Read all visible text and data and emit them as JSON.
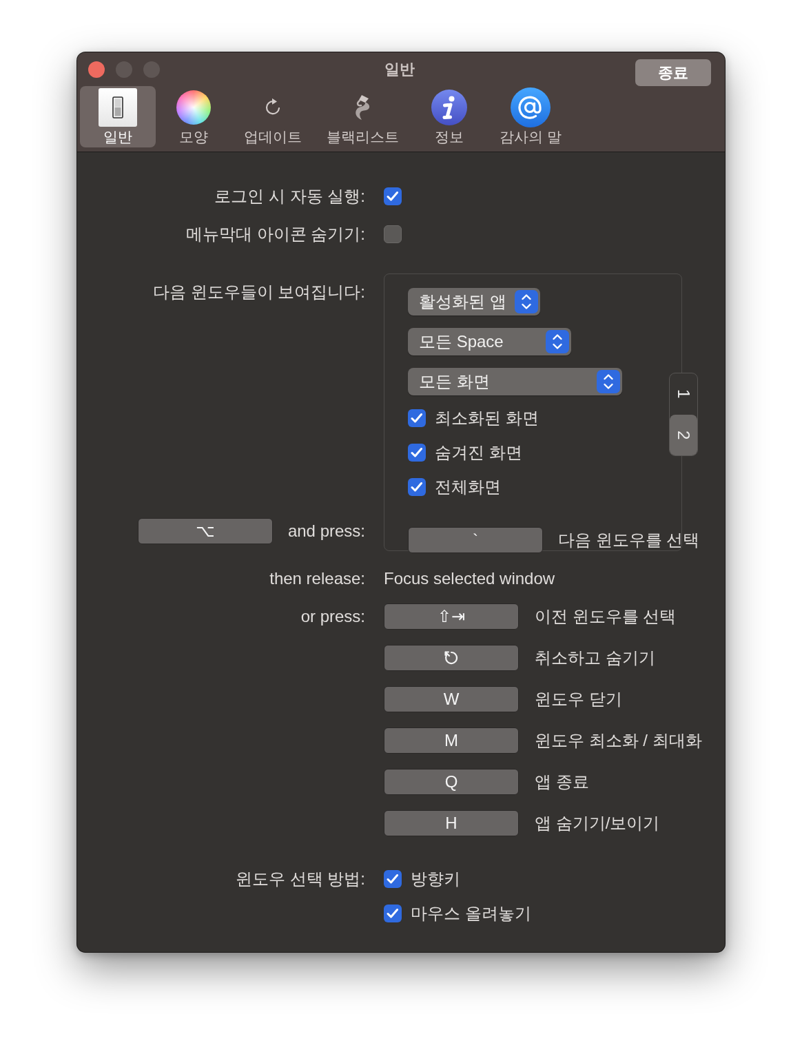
{
  "window": {
    "title": "일반",
    "buttons": [
      {
        "kind": "close",
        "disabled": false
      },
      {
        "kind": "minimize",
        "disabled": true
      },
      {
        "kind": "zoom",
        "disabled": true
      }
    ],
    "quit_button": "종료"
  },
  "toolbar": {
    "items": [
      {
        "kind": "general",
        "label": "일반",
        "selected": true
      },
      {
        "kind": "appearance",
        "label": "모양",
        "selected": false
      },
      {
        "kind": "update",
        "label": "업데이트",
        "selected": false
      },
      {
        "kind": "blacklist",
        "label": "블랙리스트",
        "selected": false
      },
      {
        "kind": "about",
        "label": "정보",
        "selected": false
      },
      {
        "kind": "thanks",
        "label": "감사의 말",
        "selected": false
      }
    ]
  },
  "options": [
    {
      "label": "로그인 시 자동 실행:",
      "checked": true
    },
    {
      "label": "메뉴막대 아이콘 숨기기:",
      "checked": false
    }
  ],
  "shortcut_panel": {
    "label": "다음 윈도우들이 보여집니다:",
    "popups": [
      {
        "value": "활성화된 앱"
      },
      {
        "value": "모든 Space"
      },
      {
        "value": "모든 화면"
      }
    ],
    "filters": [
      {
        "label": "최소화된 화면",
        "checked": true
      },
      {
        "label": "숨겨진 화면",
        "checked": true
      },
      {
        "label": "전체화면",
        "checked": true
      }
    ],
    "trigger": {
      "key": "`",
      "action": "다음 윈도우를 선택"
    },
    "pages": [
      {
        "label": "1",
        "selected": false
      },
      {
        "label": "2",
        "selected": true
      }
    ]
  },
  "hold": {
    "key": "⌥",
    "label": "and press:"
  },
  "release": {
    "label": "then release:",
    "action": "Focus selected window"
  },
  "alternatives": {
    "label": "or press:",
    "shortcuts": [
      {
        "kind": "text",
        "key": "⇧⇥",
        "action": "이전 윈도우를 선택"
      },
      {
        "kind": "icon",
        "action": "취소하고 숨기기"
      },
      {
        "kind": "text",
        "key": "W",
        "action": "윈도우 닫기"
      },
      {
        "kind": "text",
        "key": "M",
        "action": "윈도우 최소화 / 최대화"
      },
      {
        "kind": "text",
        "key": "Q",
        "action": "앱 종료"
      },
      {
        "kind": "text",
        "key": "H",
        "action": "앱 숨기기/보이기"
      }
    ]
  },
  "selection_method": {
    "label": "윈도우 선택 방법:",
    "options": [
      {
        "label": "방향키",
        "checked": true
      },
      {
        "label": "마우스 올려놓기",
        "checked": true
      }
    ]
  }
}
